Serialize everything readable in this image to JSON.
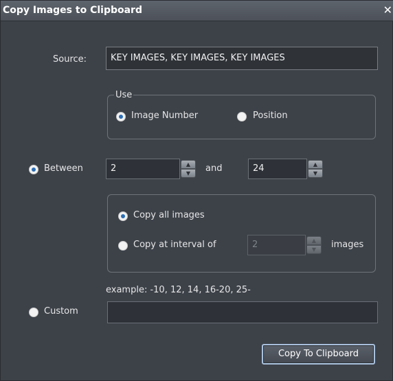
{
  "window": {
    "title": "Copy Images to Clipboard",
    "close_glyph": "✕"
  },
  "source": {
    "label": "Source:",
    "value": "KEY IMAGES, KEY IMAGES, KEY IMAGES"
  },
  "use_group": {
    "legend": "Use",
    "options": [
      {
        "label": "Image Number",
        "selected": true
      },
      {
        "label": "Position",
        "selected": false
      }
    ]
  },
  "between": {
    "label": "Between",
    "selected": true,
    "from_value": "2",
    "and_label": "and",
    "to_value": "24"
  },
  "copy_group": {
    "all_label": "Copy all images",
    "all_selected": true,
    "interval_label": "Copy at interval of",
    "interval_selected": false,
    "interval_value": "2",
    "images_label": "images"
  },
  "custom": {
    "example": "example: -10, 12, 14, 16-20, 25-",
    "label": "Custom",
    "selected": false,
    "value": ""
  },
  "button": {
    "label": "Copy To Clipboard"
  },
  "icons": {
    "spinner_up": "▲",
    "spinner_down": "▼"
  }
}
